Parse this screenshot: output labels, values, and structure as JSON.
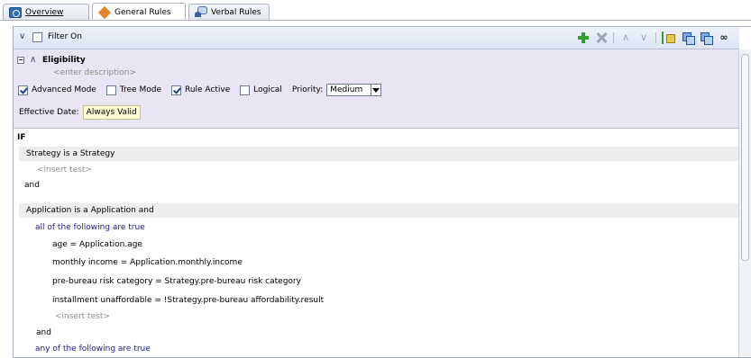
{
  "tabs": [
    {
      "label": "Overview",
      "icon": "overview-icon"
    },
    {
      "label": "General Rules",
      "icon": "rule-diamond-icon"
    },
    {
      "label": "Verbal Rules",
      "icon": "verbal-rules-icon"
    }
  ],
  "toolbar": {
    "filter_label": "Filter On",
    "icons": [
      "add-icon",
      "delete-icon",
      "move-up-icon",
      "move-down-icon",
      "tree-icon",
      "copy-icon",
      "paste-icon",
      "find-icon"
    ]
  },
  "rule": {
    "title": "Eligibility",
    "description_placeholder": "<enter description>",
    "options": [
      {
        "label": "Advanced Mode",
        "checked": true
      },
      {
        "label": "Tree Mode",
        "checked": false
      },
      {
        "label": "Rule Active",
        "checked": true
      },
      {
        "label": "Logical",
        "checked": false
      }
    ],
    "priority_label": "Priority:",
    "priority_value": "Medium",
    "effective_date_label": "Effective Date:",
    "effective_date_value": "Always Valid"
  },
  "conditions": {
    "if_label": "IF",
    "rows": [
      "Strategy is a Strategy",
      "<insert test>",
      "and",
      "Application is a Application  and",
      "all of the following are true",
      "age = Application.age",
      "monthly income = Application.monthly.income",
      "pre-bureau risk category = Strategy.pre-bureau risk category",
      "installment unaffordable = !Strategy.pre-bureau affordability.result",
      "<insert test>",
      "and",
      "any of the following are true"
    ]
  },
  "colors": {
    "rule_panel_bg": "#eae5f4",
    "toolbar_bg": "#dde4f3",
    "keyword_blue": "#1c1c9a",
    "add_green": "#2f9e2f"
  }
}
